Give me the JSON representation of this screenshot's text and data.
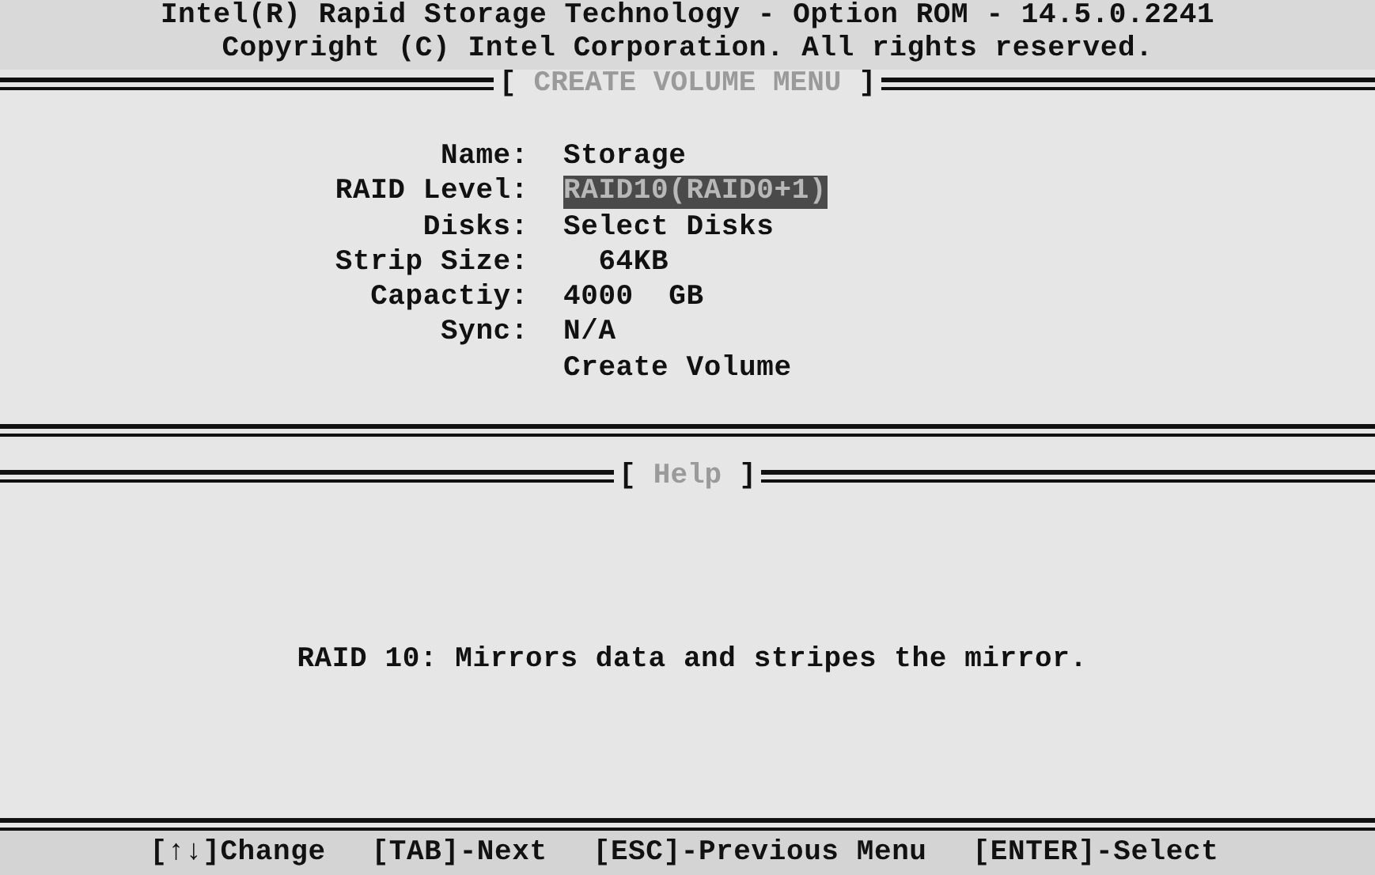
{
  "header": {
    "lines": [
      "Intel(R) Rapid Storage Technology - Option ROM - 14.5.0.2241",
      "Copyright (C) Intel Corporation. All rights reserved."
    ]
  },
  "menu": {
    "open": "[",
    "title": "CREATE VOLUME MENU",
    "close": "]",
    "fields": [
      {
        "kind": "field",
        "label": "Name:",
        "value": "Storage",
        "selected": false
      },
      {
        "kind": "field",
        "label": "RAID Level:",
        "value": "RAID10(RAID0+1)",
        "selected": true
      },
      {
        "kind": "field",
        "label": "Disks:",
        "value": "Select Disks",
        "selected": false
      },
      {
        "kind": "field",
        "label": "Strip Size:",
        "value": "  64KB",
        "selected": false
      },
      {
        "kind": "field",
        "label": "Capactiy:",
        "value": "4000  GB",
        "selected": false
      },
      {
        "kind": "field",
        "label": "Sync:",
        "value": "N/A",
        "selected": false
      },
      {
        "kind": "action",
        "value": "Create Volume",
        "selected": false
      }
    ]
  },
  "help": {
    "open": "[",
    "title": "Help",
    "close": "]",
    "text": "RAID 10: Mirrors data and stripes the mirror."
  },
  "footer": [
    "[↑↓]Change",
    "[TAB]-Next",
    "[ESC]-Previous Menu",
    "[ENTER]-Select"
  ]
}
